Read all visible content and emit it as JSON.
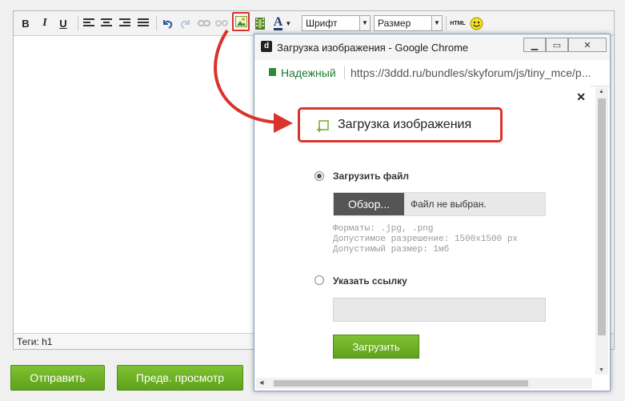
{
  "toolbar": {
    "bold": "B",
    "italic": "I",
    "underline": "U",
    "font_select": "Шрифт",
    "size_select": "Размер",
    "html": "HTML"
  },
  "editor": {
    "status_tags": "Теги: h1"
  },
  "actions": {
    "submit": "Отправить",
    "preview": "Предв. просмотр"
  },
  "popup": {
    "window_title": "Загрузка изображения - Google Chrome",
    "secure_label": "Надежный",
    "url": "https://3ddd.ru/bundles/skyforum/js/tiny_mce/p...",
    "heading": "Загрузка изображения",
    "option_file": "Загрузить файл",
    "browse_button": "Обзор...",
    "file_status": "Файл не выбран.",
    "formats": "Форматы: .jpg, .png",
    "resolution": "Допустимое разрешение: 1500х1500 px",
    "size": "Допустимый размер: 1мб",
    "option_link": "Указать ссылку",
    "upload_button": "Загрузить",
    "close": "✕"
  },
  "colors": {
    "accent_green": "#6db126",
    "highlight_red": "#d9342b"
  }
}
